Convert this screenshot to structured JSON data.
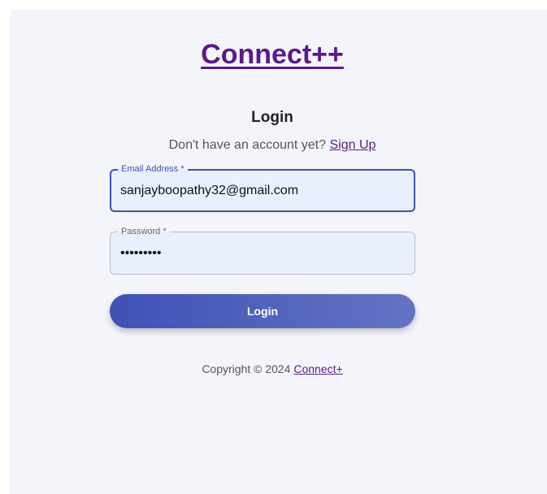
{
  "brand": {
    "name": "Connect++"
  },
  "login": {
    "heading": "Login",
    "no_account_text": "Don't have an account yet?",
    "signup_link": "Sign Up",
    "email": {
      "label": "Email Address *",
      "value": "sanjayboopathy32@gmail.com"
    },
    "password": {
      "label": "Password *",
      "value": "•••••••••"
    },
    "submit_label": "Login"
  },
  "footer": {
    "copyright_text": "Copyright © 2024",
    "link": "Connect+"
  },
  "colors": {
    "brand": "#5a1a8b",
    "accent": "#3f51b5",
    "page_background": "#f4f5fa",
    "input_background": "#e8f0fe"
  }
}
